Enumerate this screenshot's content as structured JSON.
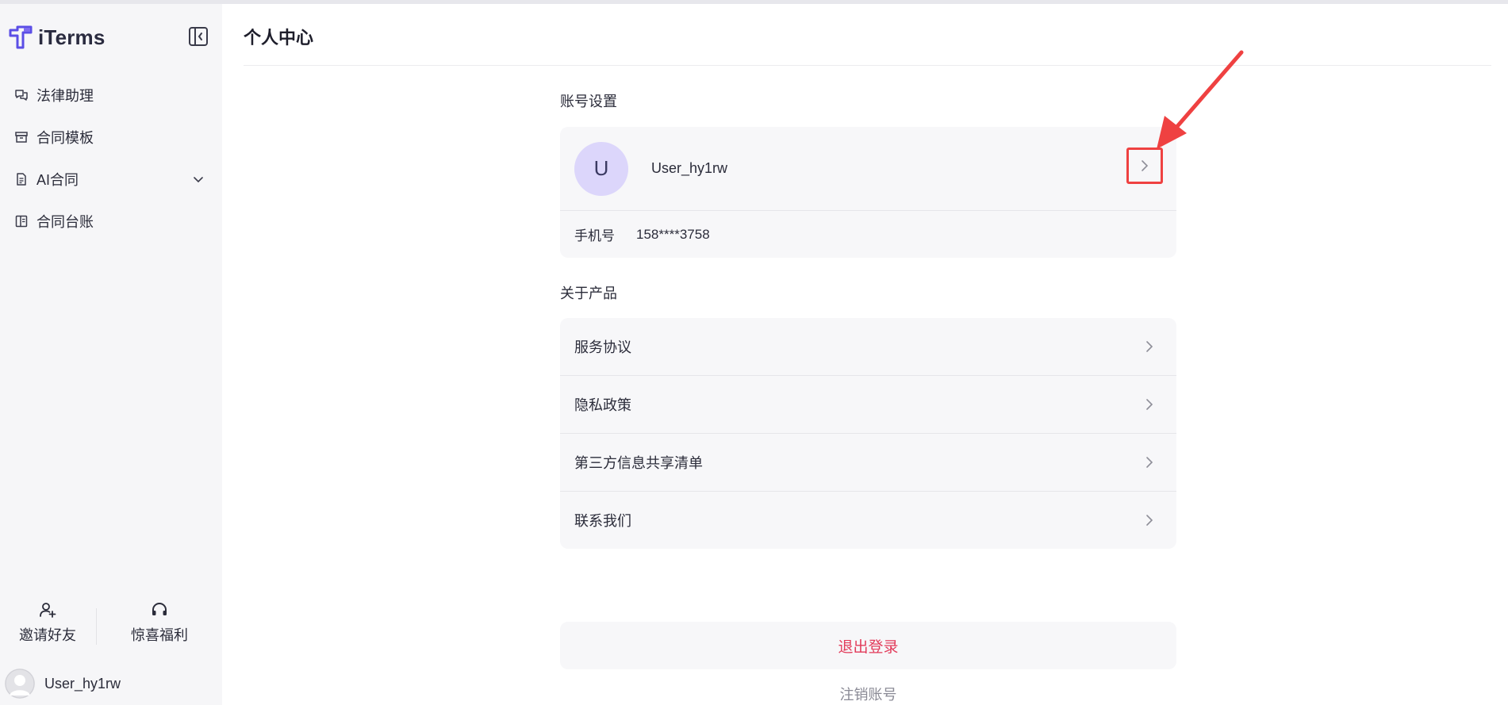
{
  "app": {
    "name": "iTerms"
  },
  "sidebar": {
    "items": [
      {
        "label": "法律助理",
        "icon": "chat-bubbles-icon"
      },
      {
        "label": "合同模板",
        "icon": "archive-box-icon"
      },
      {
        "label": "AI合同",
        "icon": "document-icon",
        "expandable": true
      },
      {
        "label": "合同台账",
        "icon": "ledger-icon"
      }
    ],
    "actions": {
      "invite": "邀请好友",
      "bonus": "惊喜福利"
    },
    "user": {
      "name": "User_hy1rw"
    }
  },
  "main": {
    "title": "个人中心",
    "account_section": {
      "heading": "账号设置",
      "avatar_letter": "U",
      "username": "User_hy1rw",
      "phone_label": "手机号",
      "phone_value": "158****3758"
    },
    "about_section": {
      "heading": "关于产品",
      "items": [
        {
          "label": "服务协议"
        },
        {
          "label": "隐私政策"
        },
        {
          "label": "第三方信息共享清单"
        },
        {
          "label": "联系我们"
        }
      ]
    },
    "logout_label": "退出登录",
    "cancel_account_label": "注销账号"
  },
  "colors": {
    "accent": "#6a52e8",
    "logout": "#e23b5a",
    "annotation": "#ef4141",
    "avatar_bg": "#dcd6fb"
  }
}
